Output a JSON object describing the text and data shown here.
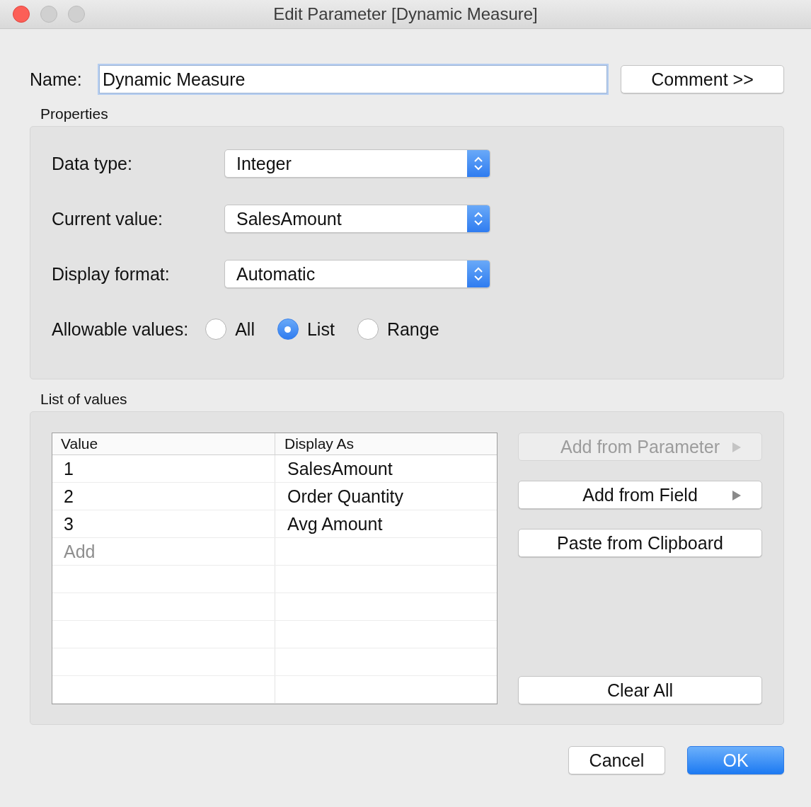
{
  "window": {
    "title": "Edit Parameter [Dynamic Measure]"
  },
  "name": {
    "label": "Name:",
    "value": "Dynamic Measure"
  },
  "comment_button": {
    "label": "Comment >>"
  },
  "properties": {
    "heading": "Properties",
    "fields": [
      {
        "label": "Data type:",
        "value": "Integer"
      },
      {
        "label": "Current value:",
        "value": "SalesAmount"
      },
      {
        "label": "Display format:",
        "value": "Automatic"
      }
    ],
    "allowable": {
      "label": "Allowable values:",
      "options": [
        {
          "label": "All",
          "selected": false
        },
        {
          "label": "List",
          "selected": true
        },
        {
          "label": "Range",
          "selected": false
        }
      ]
    }
  },
  "list_of_values": {
    "heading": "List of values",
    "table": {
      "columns": [
        "Value",
        "Display As"
      ],
      "rows": [
        {
          "value": "1",
          "display_as": "SalesAmount"
        },
        {
          "value": "2",
          "display_as": "Order Quantity"
        },
        {
          "value": "3",
          "display_as": "Avg Amount"
        }
      ],
      "add_placeholder": "Add"
    },
    "buttons": [
      {
        "label": "Add from Parameter",
        "disabled": true,
        "submenu": true
      },
      {
        "label": "Add from Field",
        "disabled": false,
        "submenu": true
      },
      {
        "label": "Paste from Clipboard",
        "disabled": false,
        "submenu": false
      },
      {
        "label": "Clear All",
        "disabled": false,
        "submenu": false
      }
    ]
  },
  "footer_buttons": [
    {
      "label": "Cancel",
      "default": false
    },
    {
      "label": "OK",
      "default": true
    }
  ]
}
